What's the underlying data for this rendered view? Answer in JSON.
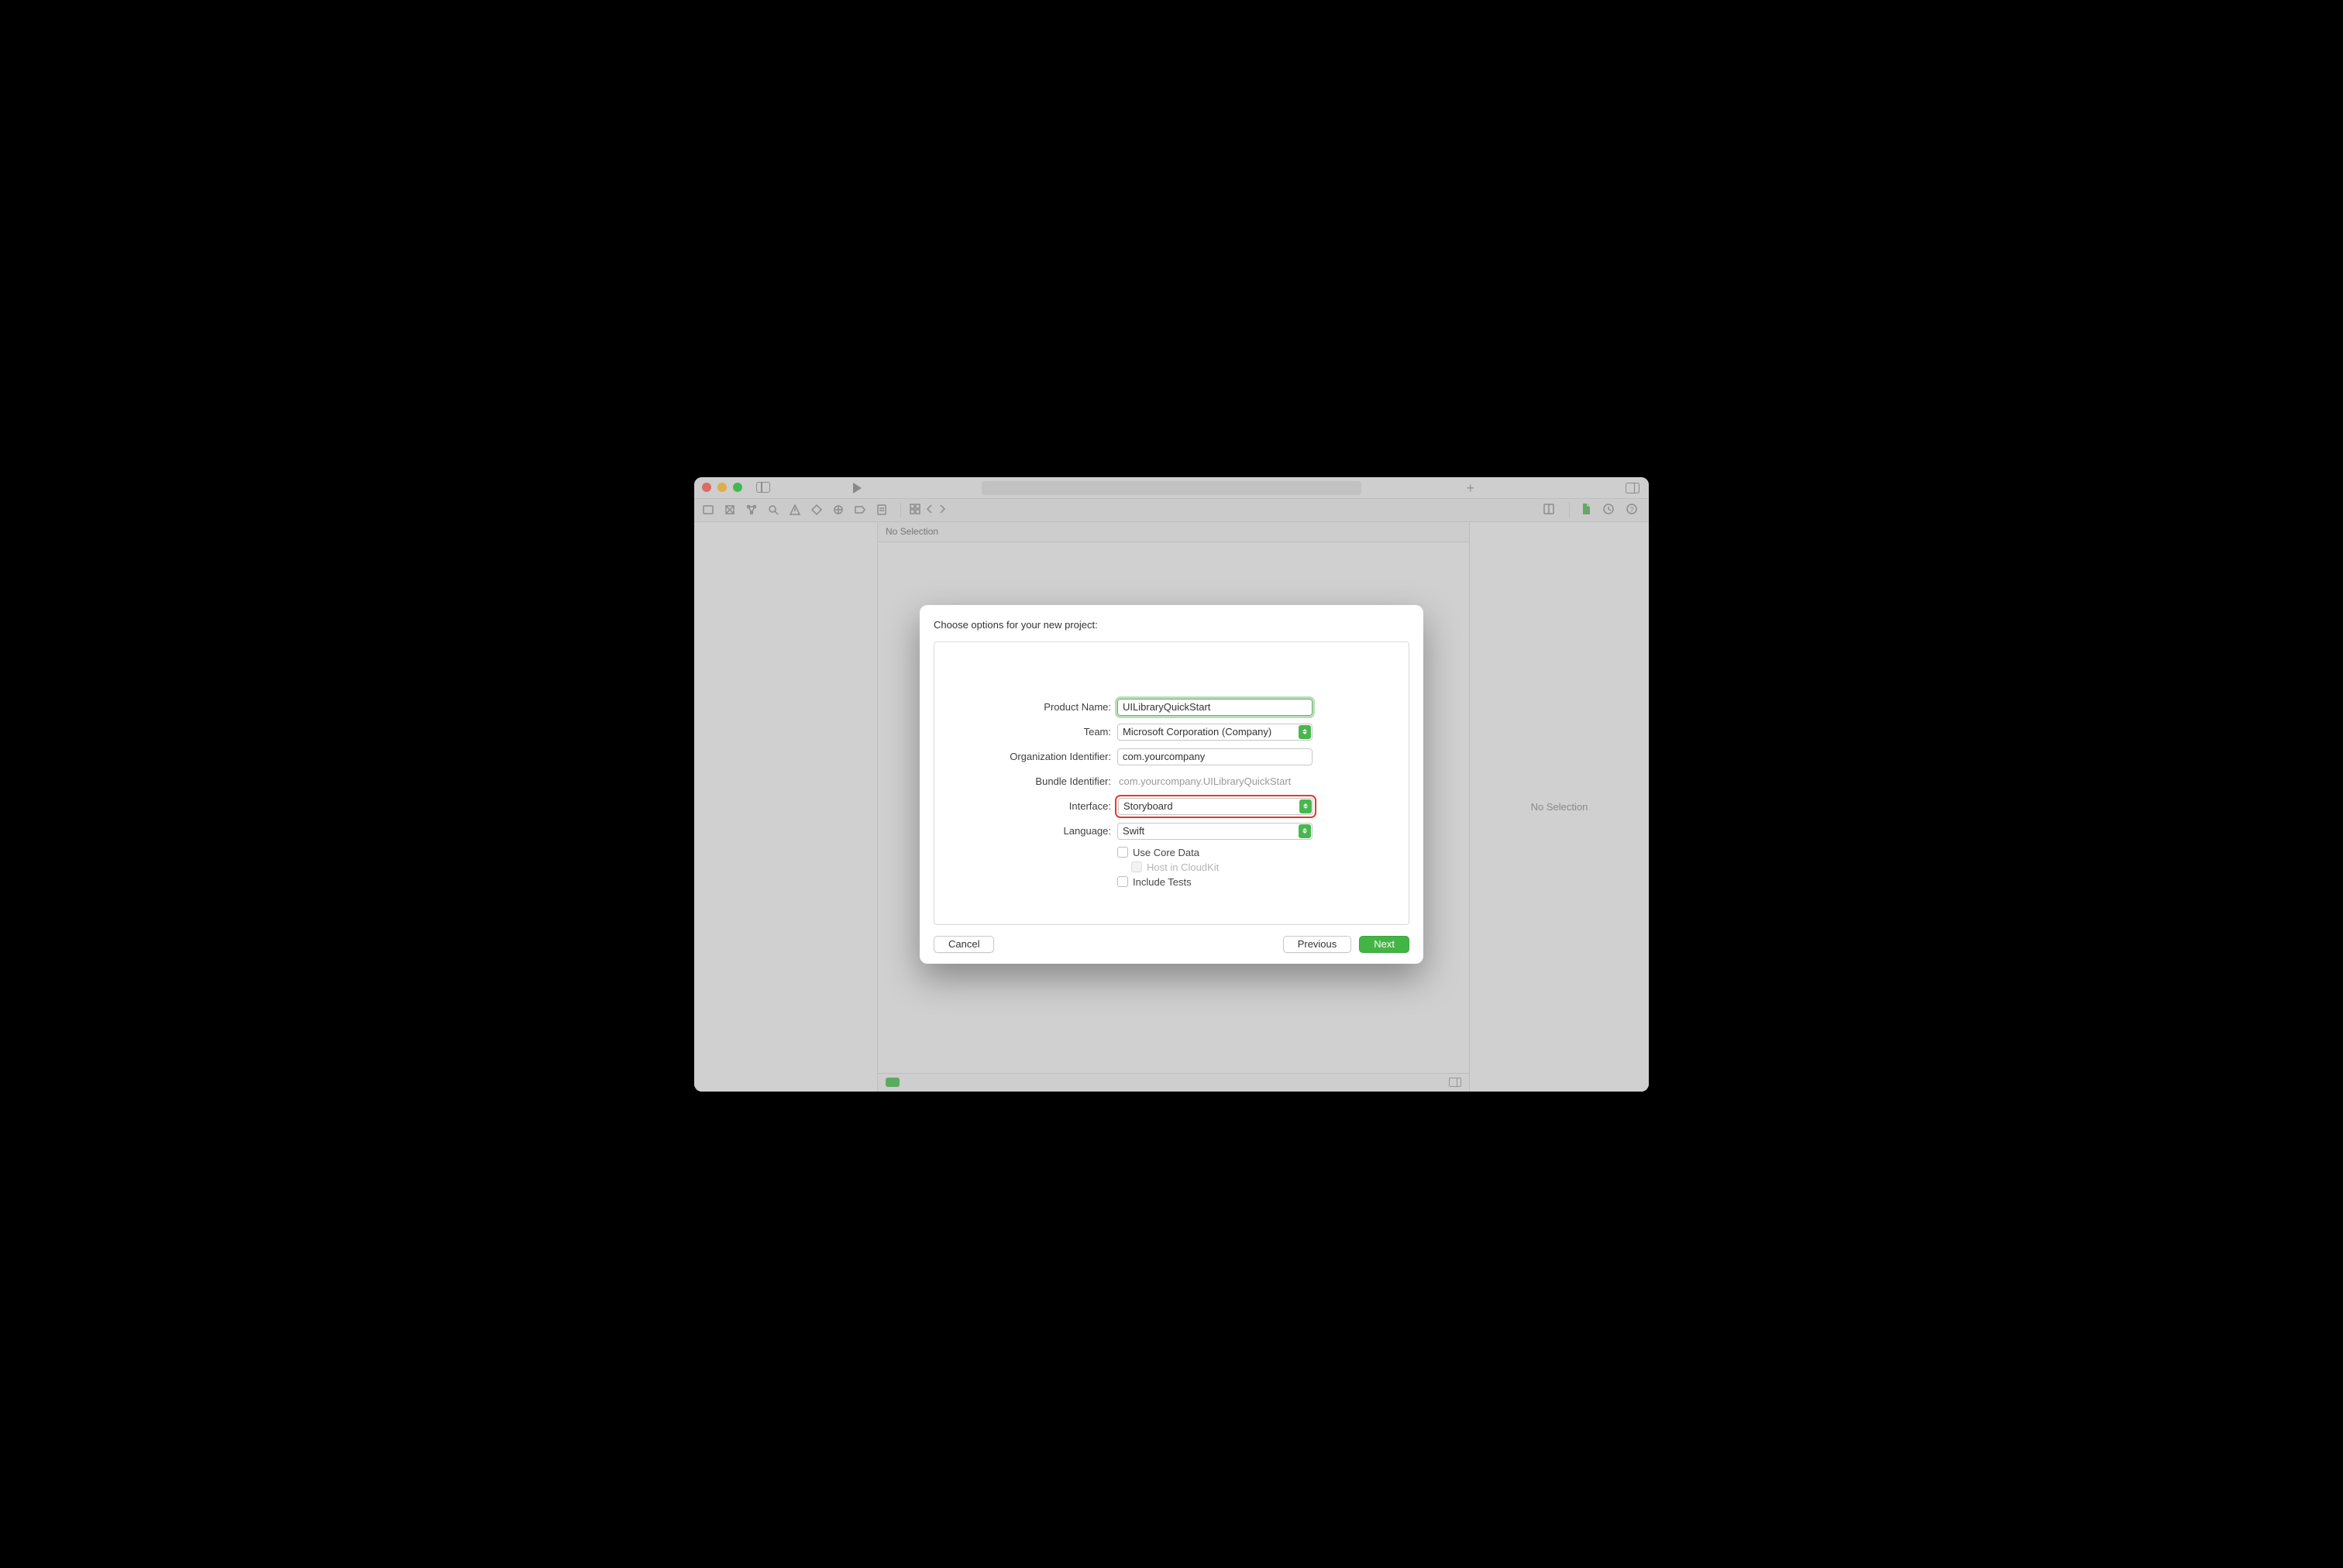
{
  "main": {
    "no_selection": "No Selection"
  },
  "inspector": {
    "no_selection": "No Selection"
  },
  "sheet": {
    "title": "Choose options for your new project:",
    "fields": {
      "product_name_label": "Product Name:",
      "product_name_value": "UILibraryQuickStart",
      "team_label": "Team:",
      "team_value": "Microsoft Corporation (Company)",
      "org_id_label": "Organization Identifier:",
      "org_id_value": "com.yourcompany",
      "bundle_id_label": "Bundle Identifier:",
      "bundle_id_value": "com.yourcompany.UILibraryQuickStart",
      "interface_label": "Interface:",
      "interface_value": "Storyboard",
      "language_label": "Language:",
      "language_value": "Swift",
      "core_data_label": "Use Core Data",
      "cloudkit_label": "Host in CloudKit",
      "tests_label": "Include Tests"
    },
    "buttons": {
      "cancel": "Cancel",
      "previous": "Previous",
      "next": "Next"
    }
  }
}
